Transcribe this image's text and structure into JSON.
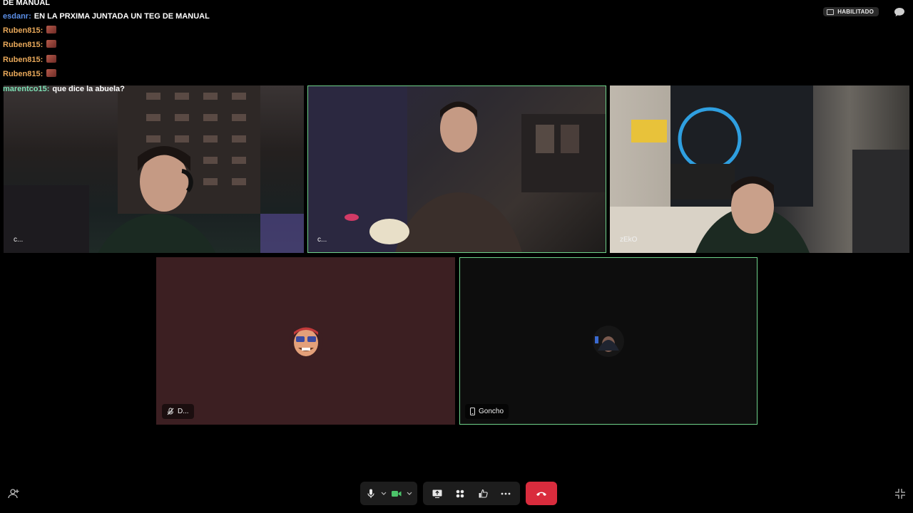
{
  "chat": {
    "partial_line": "DE MANUAL",
    "lines": [
      {
        "user": "esdanr:",
        "user_color": "#5b8fe8",
        "message": "EN LA PRXIMA JUNTADA UN TEG DE MANUAL",
        "emotes": 0,
        "wrap": true
      },
      {
        "user": "Ruben815:",
        "user_color": "#e8a85a",
        "message": "",
        "emotes": 1
      },
      {
        "user": "Ruben815:",
        "user_color": "#e8a85a",
        "message": "",
        "emotes": 1
      },
      {
        "user": "Ruben815:",
        "user_color": "#e8a85a",
        "message": "",
        "emotes": 1
      },
      {
        "user": "Ruben815:",
        "user_color": "#e8a85a",
        "message": "",
        "emotes": 1
      },
      {
        "user": "marentco15:",
        "user_color": "#7de0b5",
        "message": "que dice la abuela?",
        "emotes": 0
      }
    ]
  },
  "captions": {
    "badge_label": "HABILITADO",
    "icon": "closed-captions-icon"
  },
  "participants": [
    {
      "name": "c...",
      "active": false
    },
    {
      "name": "c...",
      "active": true
    },
    {
      "name": "zEkO",
      "active": false
    },
    {
      "name": "D...",
      "active": false,
      "muted": true,
      "icon": "mic-off-icon"
    },
    {
      "name": "Goncho",
      "active": true,
      "icon": "phone-icon"
    }
  ],
  "toolbar": {
    "mic": "microphone-icon",
    "camera": "camera-icon",
    "share": "screen-share-icon",
    "layout": "grid-icon",
    "reactions": "reaction-icon",
    "more": "more-icon",
    "end": "hang-up-icon"
  },
  "colors": {
    "accent": "#6fd28a",
    "end_call": "#d92c3d",
    "tile_bg_muted": "#3c1f22"
  }
}
